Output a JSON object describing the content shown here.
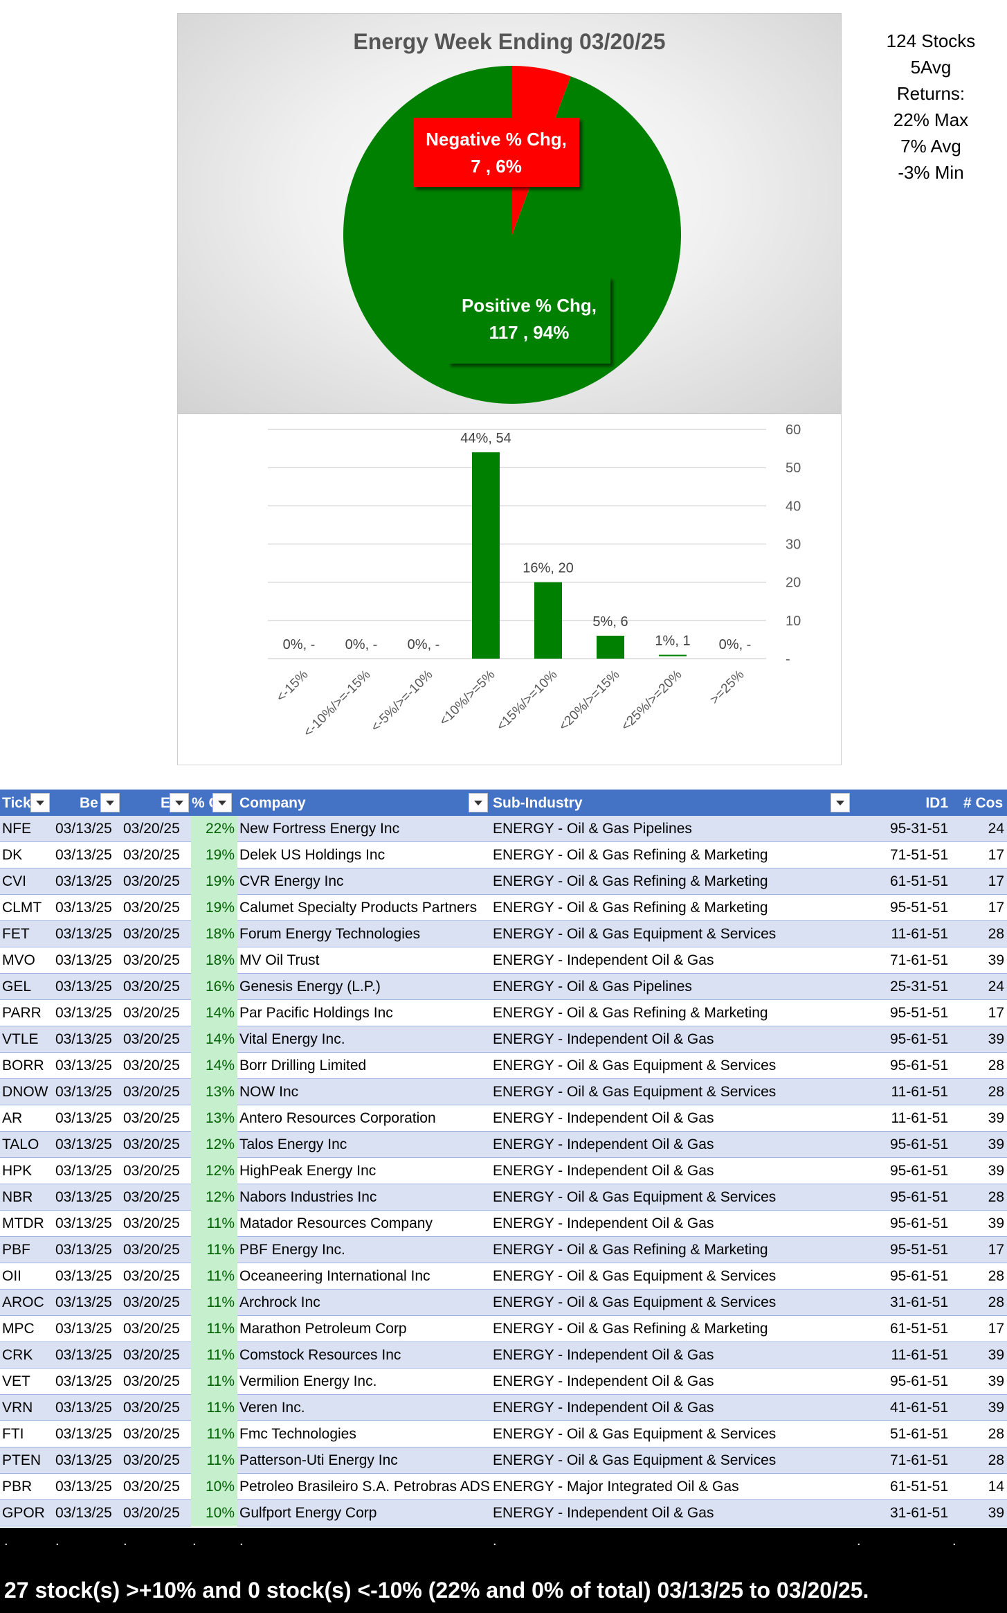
{
  "chart_data": [
    {
      "type": "pie",
      "title": "Energy Week Ending 03/20/25",
      "slices": [
        {
          "label": "Negative % Chg",
          "count": 7,
          "percent": "6%",
          "color": "#ff0000"
        },
        {
          "label": "Positive % Chg",
          "count": 117,
          "percent": "94%",
          "color": "#008000"
        }
      ],
      "data_labels": [
        {
          "line1": "Negative % Chg,",
          "line2": "7 , 6%"
        },
        {
          "line1": "Positive % Chg,",
          "line2": "117 , 94%"
        }
      ]
    },
    {
      "type": "bar",
      "categories": [
        "<-15%",
        "<-10%/>=-15%",
        "<-5%/>=-10%",
        "<10%/>=5%",
        "<15%/>=10%",
        "<20%/>=15%",
        "<25%/>=20%",
        ">=25%"
      ],
      "values": [
        0,
        0,
        0,
        54,
        20,
        6,
        1,
        0
      ],
      "data_labels": [
        "0%,  -",
        "0%,  -",
        "0%,  -",
        "44%,  54",
        "16%,  20",
        "5%,  6",
        "1%,  1",
        "0%,  -"
      ],
      "ylim": [
        0,
        60
      ],
      "yticks": [
        "-",
        "10",
        "20",
        "30",
        "40",
        "50",
        "60"
      ],
      "y_axis_side": "right",
      "grid": true,
      "bar_color": "#008000"
    }
  ],
  "stats": [
    "124 Stocks",
    "5Avg",
    "Returns:",
    "22% Max",
    "7% Avg",
    "-3% Min"
  ],
  "table": {
    "headers": [
      "Tick",
      "Be",
      "E",
      "% C",
      "Company",
      "Sub-Industry",
      "ID1",
      "# Cos"
    ],
    "rows": [
      [
        "NFE",
        "03/13/25",
        "03/20/25",
        "22%",
        "New Fortress Energy Inc",
        "ENERGY - Oil & Gas Pipelines",
        "95-31-51",
        "24"
      ],
      [
        "DK",
        "03/13/25",
        "03/20/25",
        "19%",
        "Delek US Holdings Inc",
        "ENERGY - Oil & Gas Refining & Marketing",
        "71-51-51",
        "17"
      ],
      [
        "CVI",
        "03/13/25",
        "03/20/25",
        "19%",
        "CVR Energy Inc",
        "ENERGY - Oil & Gas Refining & Marketing",
        "61-51-51",
        "17"
      ],
      [
        "CLMT",
        "03/13/25",
        "03/20/25",
        "19%",
        "Calumet Specialty Products Partners",
        "ENERGY - Oil & Gas Refining & Marketing",
        "95-51-51",
        "17"
      ],
      [
        "FET",
        "03/13/25",
        "03/20/25",
        "18%",
        "Forum Energy Technologies",
        "ENERGY - Oil & Gas Equipment & Services",
        "11-61-51",
        "28"
      ],
      [
        "MVO",
        "03/13/25",
        "03/20/25",
        "18%",
        "MV Oil Trust",
        "ENERGY - Independent Oil & Gas",
        "71-61-51",
        "39"
      ],
      [
        "GEL",
        "03/13/25",
        "03/20/25",
        "16%",
        "Genesis Energy (L.P.)",
        "ENERGY - Oil & Gas Pipelines",
        "25-31-51",
        "24"
      ],
      [
        "PARR",
        "03/13/25",
        "03/20/25",
        "14%",
        "Par Pacific Holdings Inc",
        "ENERGY - Oil & Gas Refining & Marketing",
        "95-51-51",
        "17"
      ],
      [
        "VTLE",
        "03/13/25",
        "03/20/25",
        "14%",
        "Vital Energy Inc.",
        "ENERGY - Independent Oil & Gas",
        "95-61-51",
        "39"
      ],
      [
        "BORR",
        "03/13/25",
        "03/20/25",
        "14%",
        "Borr Drilling Limited",
        "ENERGY - Oil & Gas Equipment & Services",
        "95-61-51",
        "28"
      ],
      [
        "DNOW",
        "03/13/25",
        "03/20/25",
        "13%",
        "NOW Inc",
        "ENERGY - Oil & Gas Equipment & Services",
        "11-61-51",
        "28"
      ],
      [
        "AR",
        "03/13/25",
        "03/20/25",
        "13%",
        "Antero Resources Corporation",
        "ENERGY - Independent Oil & Gas",
        "11-61-51",
        "39"
      ],
      [
        "TALO",
        "03/13/25",
        "03/20/25",
        "12%",
        "Talos Energy Inc",
        "ENERGY - Independent Oil & Gas",
        "95-61-51",
        "39"
      ],
      [
        "HPK",
        "03/13/25",
        "03/20/25",
        "12%",
        "HighPeak Energy Inc",
        "ENERGY - Independent Oil & Gas",
        "95-61-51",
        "39"
      ],
      [
        "NBR",
        "03/13/25",
        "03/20/25",
        "12%",
        "Nabors Industries Inc",
        "ENERGY - Oil & Gas Equipment & Services",
        "95-61-51",
        "28"
      ],
      [
        "MTDR",
        "03/13/25",
        "03/20/25",
        "11%",
        "Matador Resources Company",
        "ENERGY - Independent Oil & Gas",
        "95-61-51",
        "39"
      ],
      [
        "PBF",
        "03/13/25",
        "03/20/25",
        "11%",
        "PBF Energy Inc.",
        "ENERGY - Oil & Gas Refining & Marketing",
        "95-51-51",
        "17"
      ],
      [
        "OII",
        "03/13/25",
        "03/20/25",
        "11%",
        "Oceaneering International Inc",
        "ENERGY - Oil & Gas Equipment & Services",
        "95-61-51",
        "28"
      ],
      [
        "AROC",
        "03/13/25",
        "03/20/25",
        "11%",
        "Archrock Inc",
        "ENERGY - Oil & Gas Equipment & Services",
        "31-61-51",
        "28"
      ],
      [
        "MPC",
        "03/13/25",
        "03/20/25",
        "11%",
        "Marathon Petroleum Corp",
        "ENERGY - Oil & Gas Refining & Marketing",
        "61-51-51",
        "17"
      ],
      [
        "CRK",
        "03/13/25",
        "03/20/25",
        "11%",
        "Comstock Resources Inc",
        "ENERGY - Independent Oil & Gas",
        "11-61-51",
        "39"
      ],
      [
        "VET",
        "03/13/25",
        "03/20/25",
        "11%",
        "Vermilion Energy Inc.",
        "ENERGY - Independent Oil & Gas",
        "95-61-51",
        "39"
      ],
      [
        "VRN",
        "03/13/25",
        "03/20/25",
        "11%",
        "Veren Inc.",
        "ENERGY - Independent Oil & Gas",
        "41-61-51",
        "39"
      ],
      [
        "FTI",
        "03/13/25",
        "03/20/25",
        "11%",
        "Fmc Technologies",
        "ENERGY - Oil & Gas Equipment & Services",
        "51-61-51",
        "28"
      ],
      [
        "PTEN",
        "03/13/25",
        "03/20/25",
        "11%",
        "Patterson-Uti Energy Inc",
        "ENERGY - Oil & Gas Equipment & Services",
        "71-61-51",
        "28"
      ],
      [
        "PBR",
        "03/13/25",
        "03/20/25",
        "10%",
        "Petroleo Brasileiro S.A. Petrobras ADS",
        "ENERGY - Major Integrated Oil & Gas",
        "61-51-51",
        "14"
      ],
      [
        "GPOR",
        "03/13/25",
        "03/20/25",
        "10%",
        "Gulfport Energy Corp",
        "ENERGY - Independent Oil & Gas",
        "31-61-51",
        "39"
      ]
    ]
  },
  "footer": {
    "dots": [
      ".",
      ".",
      ".",
      ".",
      ".",
      ".",
      ".",
      "."
    ],
    "summary": "27 stock(s) >+10% and 0 stock(s) <-10% (22% and 0% of total) 03/13/25 to 03/20/25."
  },
  "colors": {
    "header_bg": "#4472c4",
    "band": "#d9e1f2",
    "pct_fill": "#c6efce",
    "pct_text": "#006100"
  }
}
